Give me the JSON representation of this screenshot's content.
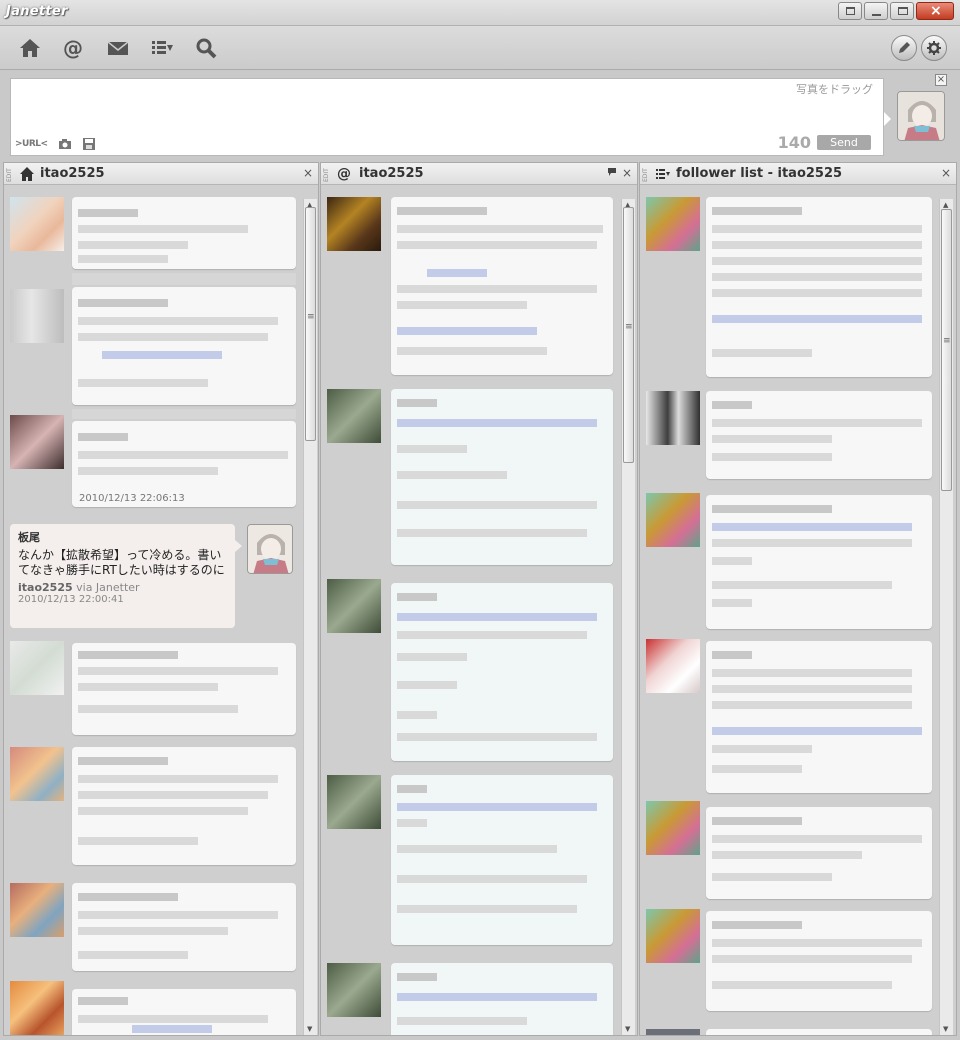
{
  "window": {
    "title": "Janetter"
  },
  "toolbar": {
    "icons": [
      "home-icon",
      "mention-icon",
      "mail-icon",
      "list-icon",
      "search-icon"
    ]
  },
  "compose": {
    "drop_hint": "写真をドラッグ",
    "url_label": ">URL<",
    "counter": "140",
    "send_label": "Send",
    "close": "×"
  },
  "columns": [
    {
      "title": "itao2525",
      "icon": "home-icon",
      "edit": "EDIT",
      "close": "×"
    },
    {
      "title": "itao2525",
      "icon": "at-icon",
      "edit": "EDIT",
      "close": "×"
    },
    {
      "title": "follower list - itao2525",
      "icon": "list-icon",
      "edit": "EDIT",
      "close": "×"
    }
  ],
  "timeline": {
    "timestamp_1": "2010/12/13  22:06:13",
    "own_tweet": {
      "name": "板尾",
      "text": "なんか【拡散希望】って冷める。書いてなきゃ勝手にRTしたい時はするのに",
      "user": "itao2525",
      "via": "via Janetter",
      "time": "2010/12/13  22:00:41"
    }
  },
  "colors": {
    "accent": "#c33c22",
    "bubble": "#f7f7f7",
    "own_bubble": "#f4efed",
    "link_bar": "#c2cbe8"
  }
}
